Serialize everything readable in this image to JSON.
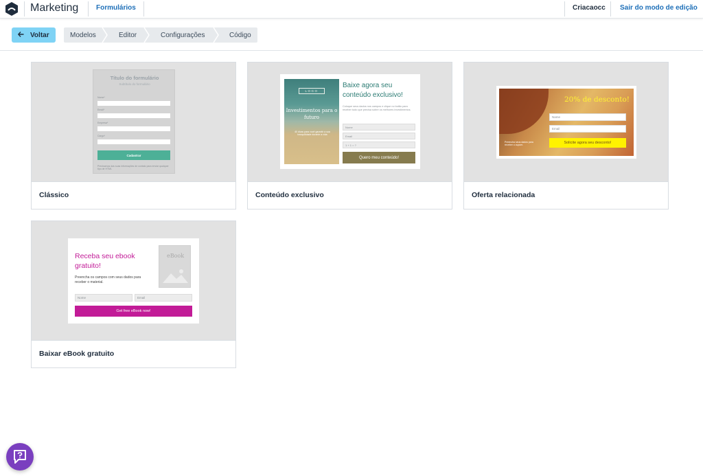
{
  "header": {
    "app_title": "Marketing",
    "nav_tab": "Formulários",
    "user": "Criacaocc",
    "exit_edit": "Sair do modo de edição"
  },
  "toolbar": {
    "back_label": "Voltar",
    "steps": [
      "Modelos",
      "Editor",
      "Configurações",
      "Código"
    ]
  },
  "templates": [
    {
      "name": "Clássico",
      "form": {
        "title": "Título do formulário",
        "subtitle": "Subtítulo do formulário",
        "fields": [
          "Nome*",
          "Email*",
          "Empresa*",
          "Cargo*"
        ],
        "button": "Cadastrar",
        "footer": "Precisamos das suas informações de contato para enviar qualquer tipo de HTML"
      }
    },
    {
      "name": "Conteúdo exclusivo",
      "form": {
        "logo": "LOGO",
        "image_title": "Investimentos para o futuro",
        "image_text": "40 dicas para você garantir a sua tranquilidade durante a vida",
        "heading": "Baixe agora seu conteúdo exclusivo!",
        "text": "Coloque seus dados nos campos e clique no botão para receber tudo que precisa sobre os melhores investimentos.",
        "fields": [
          "Nome",
          "Email",
          "1 + 1 = ?"
        ],
        "button": "Quero meu conteúdo!"
      }
    },
    {
      "name": "Oferta relacionada",
      "form": {
        "heading": "20% de desconto!",
        "fields": [
          "Name",
          "Email"
        ],
        "button": "Solicite agora seu desconto!",
        "note": "Preencha seus dados para receber o cupom."
      }
    },
    {
      "name": "Baixar eBook gratuito",
      "form": {
        "heading": "Receba seu ebook gratuito!",
        "text": "Preencha os campos com seus dados para receber o material.",
        "book_label": "eBook",
        "fields": [
          "Nome",
          "Email"
        ],
        "button": "Get free eBook now!"
      }
    }
  ],
  "colors": {
    "accent_blue": "#1d6fb8",
    "back_button": "#7fd3f5",
    "classic_button": "#4db097",
    "exclusive_button": "#867b4e",
    "offer_button": "#fff200",
    "ebook_accent": "#c21b97",
    "help_button": "#7a3fbf"
  },
  "help": {
    "icon": "chat-help-icon"
  }
}
